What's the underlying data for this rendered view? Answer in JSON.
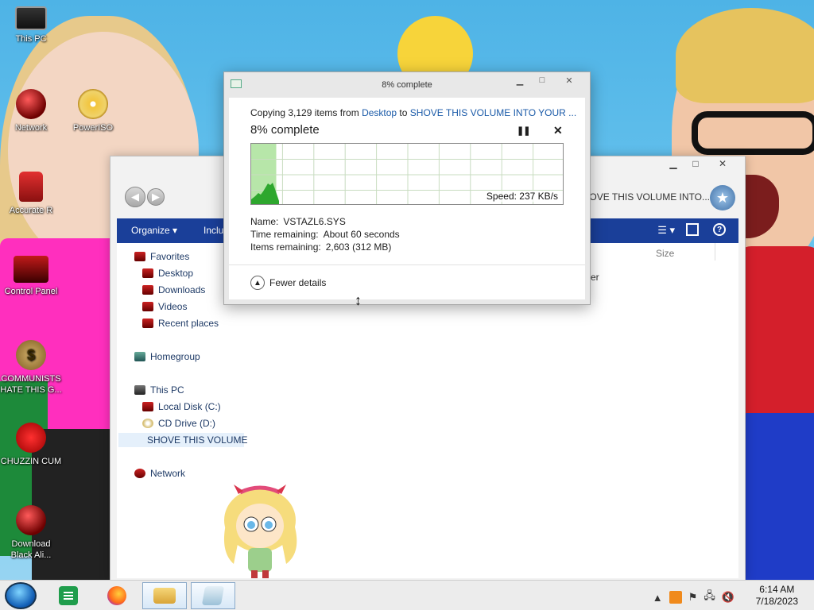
{
  "desktop": {
    "icons": [
      {
        "label": "This PC",
        "icon": "monitor-icon"
      },
      {
        "label": "Network",
        "icon": "network-icon"
      },
      {
        "label": "PowerISO",
        "icon": "disc-icon"
      },
      {
        "label": "Accurate R",
        "icon": "paint-can-icon"
      },
      {
        "label": "Control Panel",
        "icon": "control-panel-icon"
      },
      {
        "label": "COMMUNISTS HATE THIS G...",
        "icon": "money-bag-icon"
      },
      {
        "label": "CHUZZIN CUM",
        "icon": "fuzzy-icon"
      },
      {
        "label": "Download Black Ali...",
        "icon": "download-icon"
      }
    ]
  },
  "explorer": {
    "search_text": "arch SHOVE THIS VOLUME INTO...",
    "cmdbar": {
      "organize": "Organize ▾",
      "include": "Inclu",
      "help": "?"
    },
    "column_size": "Size",
    "fragment_text": "er",
    "nav": {
      "favorites": "Favorites",
      "desktop": "Desktop",
      "downloads": "Downloads",
      "videos": "Videos",
      "recent": "Recent places",
      "homegroup": "Homegroup",
      "this_pc": "This PC",
      "local_disk": "Local Disk (C:)",
      "cd_drive": "CD Drive (D:)",
      "shove": "SHOVE THIS VOLUME",
      "network": "Network"
    }
  },
  "copy_dialog": {
    "title": "8% complete",
    "copy_prefix": "Copying 3,129 items from ",
    "source": "Desktop",
    "to_word": " to ",
    "destination": "SHOVE THIS VOLUME INTO YOUR ...",
    "heading": "8% complete",
    "percent": 8,
    "pause_glyph": "❚❚",
    "cancel_glyph": "✕",
    "speed": "Speed: 237 KB/s",
    "details": {
      "name_label": "Name:",
      "name_value": "VSTAZL6.SYS",
      "time_label": "Time remaining:",
      "time_value": "About 60 seconds",
      "items_label": "Items remaining:",
      "items_value": "2,603 (312 MB)"
    },
    "fewer_details": "Fewer details",
    "colors": {
      "progress_fill": "#b7e6a9",
      "graph_fill": "#2ea72e",
      "link": "#1a5aa8"
    }
  },
  "taskbar": {
    "clock_time": "6:14 AM",
    "clock_date": "7/18/2023",
    "tray_chevron": "▲"
  },
  "colors": {
    "cmdbar": "#1a3f99",
    "taskbar": "#ececec"
  }
}
